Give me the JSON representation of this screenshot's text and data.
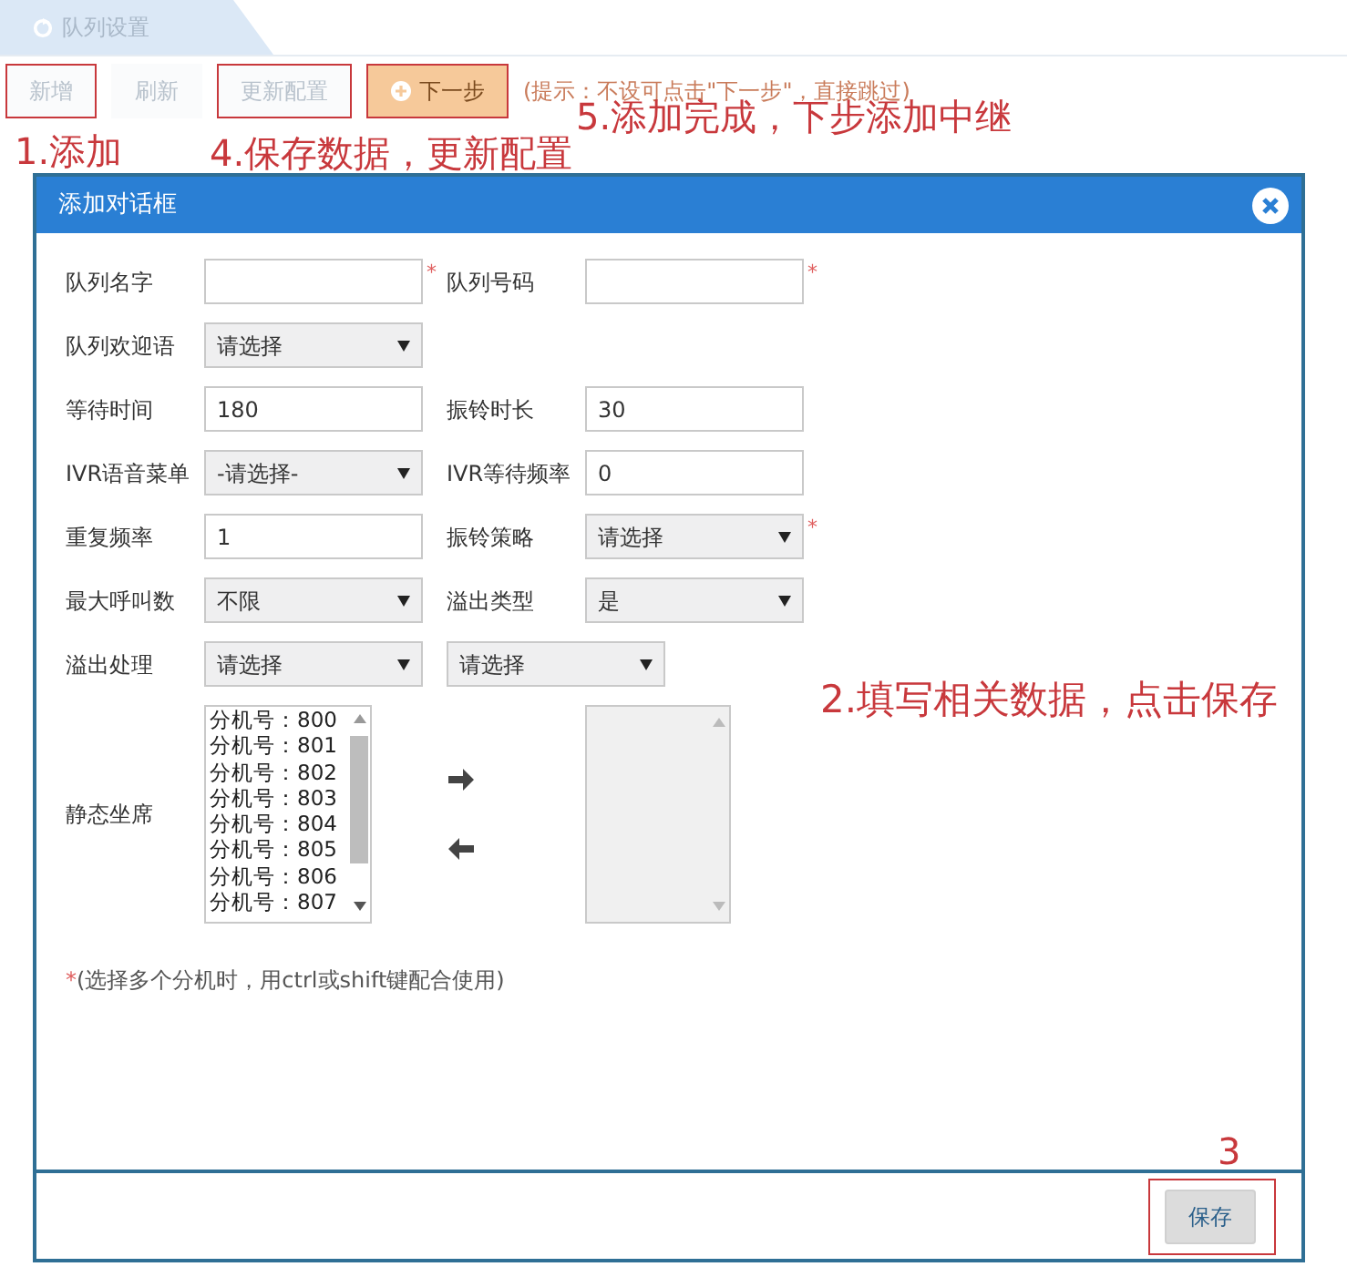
{
  "background": {
    "tab": {
      "label": "队列设置"
    },
    "buttons": [
      {
        "label": "新增",
        "kind": "plain",
        "highlighted": true
      },
      {
        "label": "刷新",
        "kind": "plain",
        "highlighted": false
      },
      {
        "label": "更新配置",
        "kind": "plain",
        "highlighted": true
      },
      {
        "label": "下一步",
        "kind": "next",
        "highlighted": true
      }
    ],
    "hint": "(提示：不设可点击\"下一步\"，直接跳过)"
  },
  "dialog": {
    "title": "添加对话框",
    "rows": [
      [
        {
          "label": "队列名字",
          "kind": "input",
          "required": true
        },
        {
          "label": "队列号码",
          "kind": "input",
          "required": true
        }
      ],
      [
        {
          "label": "队列欢迎语",
          "kind": "select",
          "value": "请选择",
          "required": false
        }
      ],
      [
        {
          "label": "等待时间",
          "kind": "input",
          "value": "180",
          "required": false
        },
        {
          "label": "振铃时长",
          "kind": "input",
          "value": "30",
          "required": false
        }
      ],
      [
        {
          "label": "IVR语音菜单",
          "kind": "select",
          "value": "-请选择-",
          "required": false
        },
        {
          "label": "IVR等待频率",
          "kind": "input",
          "value": "0",
          "required": false
        }
      ],
      [
        {
          "label": "重复频率",
          "kind": "input",
          "value": "1",
          "required": false
        },
        {
          "label": "振铃策略",
          "kind": "select",
          "value": "请选择",
          "required": true
        }
      ],
      [
        {
          "label": "最大呼叫数",
          "kind": "select",
          "value": "不限",
          "required": false
        },
        {
          "label": "溢出类型",
          "kind": "select",
          "value": "是",
          "required": false
        }
      ],
      [
        {
          "label": "溢出处理",
          "kind": "select",
          "value": "请选择",
          "required": false
        },
        {
          "kind": "select",
          "value": "请选择",
          "required": false
        }
      ]
    ],
    "static_seats": {
      "label": "静态坐席",
      "available": [
        "分机号：800",
        "分机号：801",
        "分机号：802",
        "分机号：803",
        "分机号：804",
        "分机号：805",
        "分机号：806",
        "分机号：807"
      ]
    },
    "note": {
      "mark": "*",
      "text": "(选择多个分机时，用ctrl或shift键配合使用)"
    },
    "save_button": {
      "label": "保存",
      "highlighted": true
    }
  },
  "annotations": [
    {
      "text": "1.添加",
      "kind": "step1"
    },
    {
      "text": "4.保存数据，更新配置",
      "kind": "step4"
    },
    {
      "text": "5.添加完成，下步添加中继",
      "kind": "step5"
    },
    {
      "text": "2.填写相关数据，点击保存",
      "kind": "step2"
    },
    {
      "text": "3",
      "kind": "step3"
    }
  ]
}
